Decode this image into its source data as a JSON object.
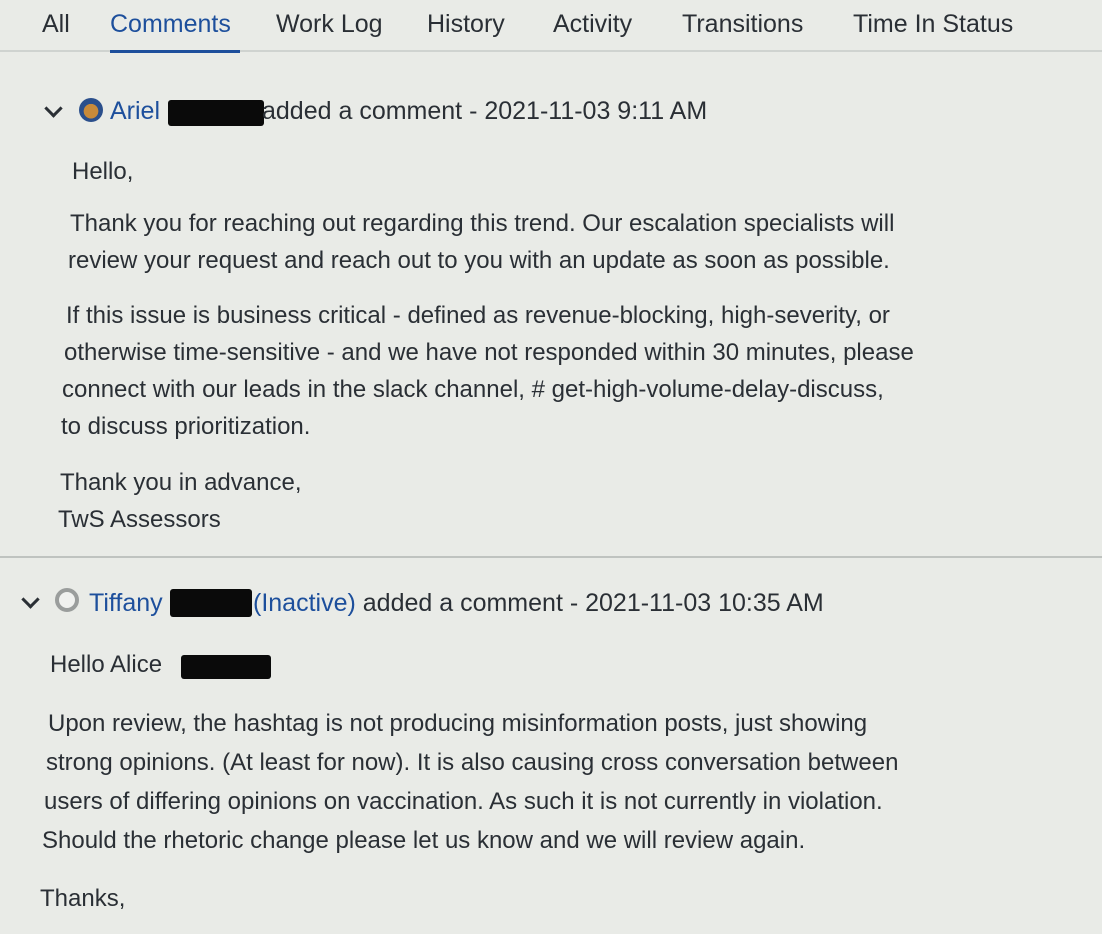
{
  "tabs": [
    {
      "label": "All"
    },
    {
      "label": "Comments"
    },
    {
      "label": "Work Log"
    },
    {
      "label": "History"
    },
    {
      "label": "Activity"
    },
    {
      "label": "Transitions"
    },
    {
      "label": "Time In Status"
    }
  ],
  "active_tab": "Comments",
  "comments": [
    {
      "author": "Ariel",
      "action": "added a comment - 2021-11-03 9:11 AM",
      "lines": [
        "Hello,",
        "Thank you for reaching out regarding this trend. Our escalation specialists will",
        "review your request and reach out to you with an update as soon as possible.",
        "If this issue is business critical - defined as revenue-blocking, high-severity, or",
        "otherwise time-sensitive - and we have not responded within 30 minutes, please",
        "connect with our leads in the slack channel, # get-high-volume-delay-discuss,",
        "to discuss prioritization.",
        "Thank you in advance,",
        "TwS Assessors"
      ]
    },
    {
      "author": "Tiffany",
      "status": "(Inactive)",
      "action": "added a comment - 2021-11-03 10:35 AM",
      "lines": [
        "Hello Alice",
        "Upon review, the hashtag is not producing misinformation posts, just showing",
        "strong opinions. (At least for now). It is also causing cross conversation between",
        "users of differing opinions on vaccination. As such it is not currently in violation.",
        "Should the rhetoric change please let us know and we will review again.",
        "Thanks,"
      ]
    }
  ],
  "icons": {
    "collapse": "chevron-down-icon",
    "avatar": "user-avatar-icon"
  },
  "colors": {
    "link": "#1d4f9c",
    "text": "#2a2f35",
    "background": "#e9ebe7"
  }
}
